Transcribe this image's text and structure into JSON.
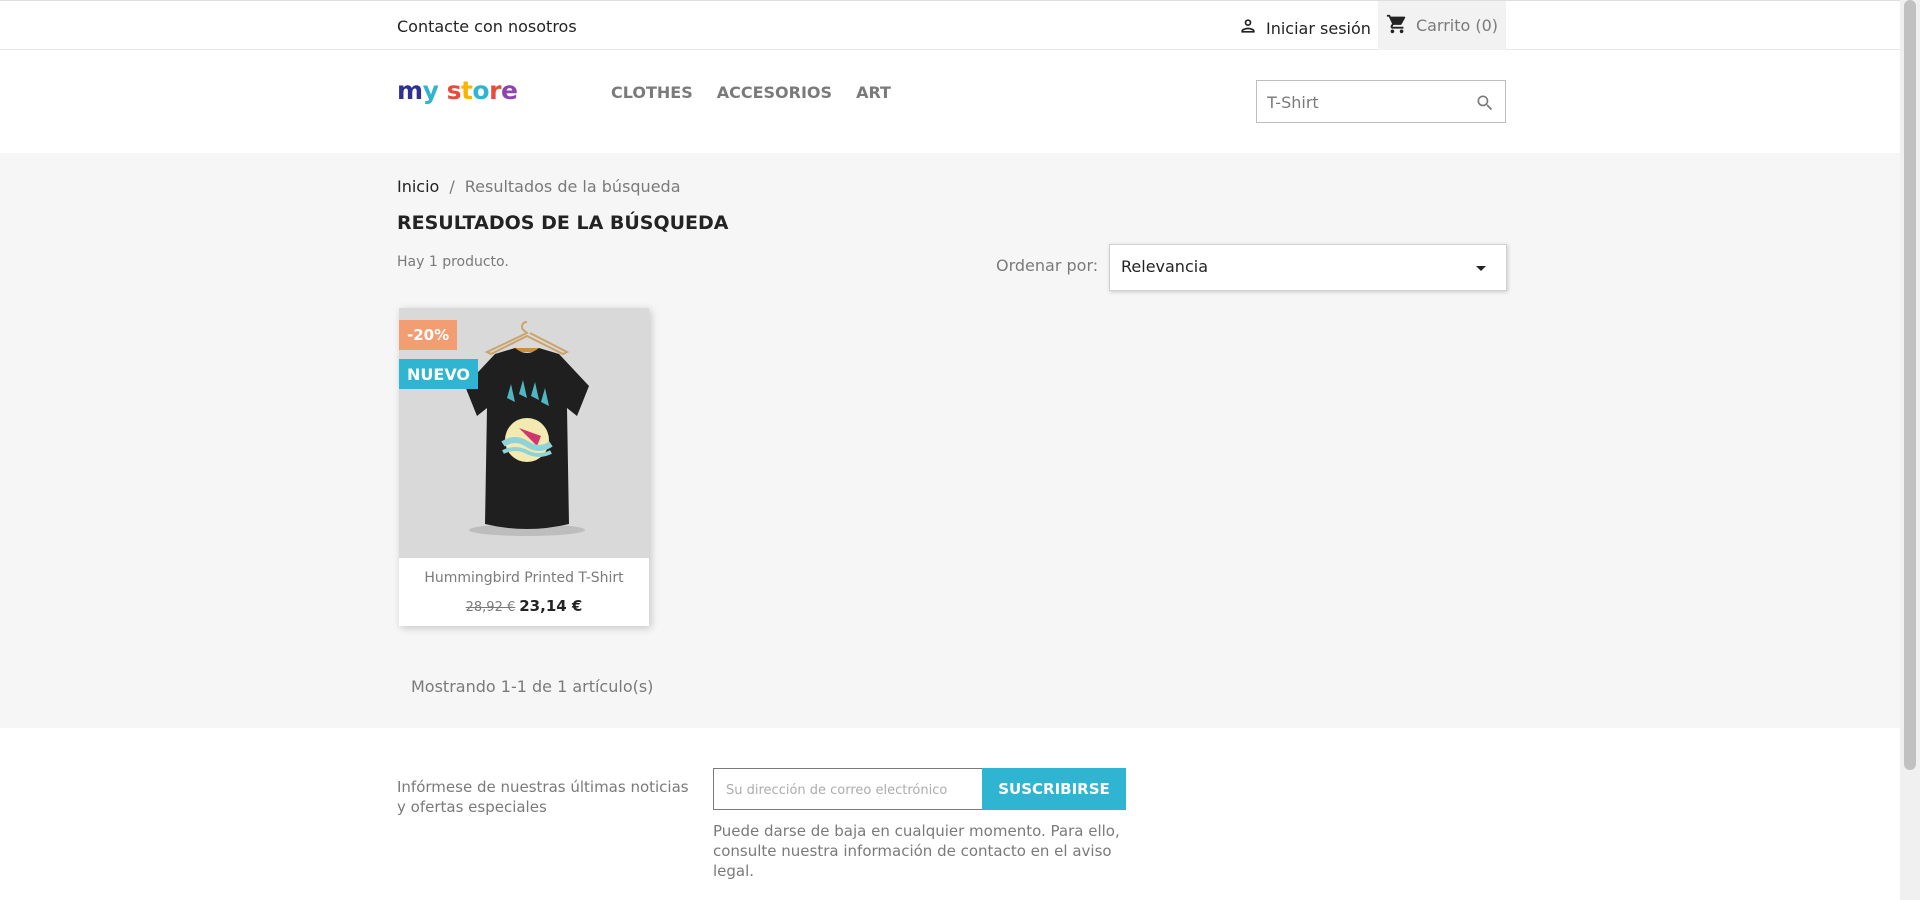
{
  "topbar": {
    "contact": "Contacte con nosotros",
    "signin": "Iniciar sesión",
    "cart": "Carrito (0)"
  },
  "header": {
    "logo": [
      "my",
      " ",
      "store"
    ],
    "nav": [
      "CLOTHES",
      "ACCESORIOS",
      "ART"
    ],
    "search_value": "T-Shirt"
  },
  "main": {
    "breadcrumb": {
      "home": "Inicio",
      "separator": "/",
      "current": "Resultados de la búsqueda"
    },
    "title": "RESULTADOS DE LA BÚSQUEDA",
    "count": "Hay 1 producto.",
    "sort_label": "Ordenar por:",
    "sort_value": "Relevancia",
    "product": {
      "flag_discount": "-20%",
      "flag_new": "NUEVO",
      "name": "Hummingbird Printed T-Shirt",
      "old_price": "28,92 €",
      "price": "23,14 €"
    },
    "showing": "Mostrando 1-1 de 1 artículo(s)"
  },
  "footer": {
    "newsletter_text": "Infórmese de nuestras últimas noticias y ofertas especiales",
    "email_placeholder": "Su dirección de correo electrónico",
    "subscribe": "SUSCRIBIRSE",
    "legal": "Puede darse de baja en cualquier momento. Para ello, consulte nuestra información de contacto en el aviso legal."
  },
  "colors": {
    "accent": "#2fb5d2",
    "discount": "#f39d72",
    "logo_m": "#2fb5d2",
    "logo_y": "#2e3192",
    "logo_s": "#e64c3c",
    "logo_t": "#f7b500",
    "logo_o": "#2fb5d2",
    "logo_r": "#e64c3c",
    "logo_e": "#8e44ad"
  },
  "icons": {
    "signin": "person-icon",
    "cart": "cart-icon",
    "search": "search-icon",
    "sort": "caret-down-icon"
  }
}
